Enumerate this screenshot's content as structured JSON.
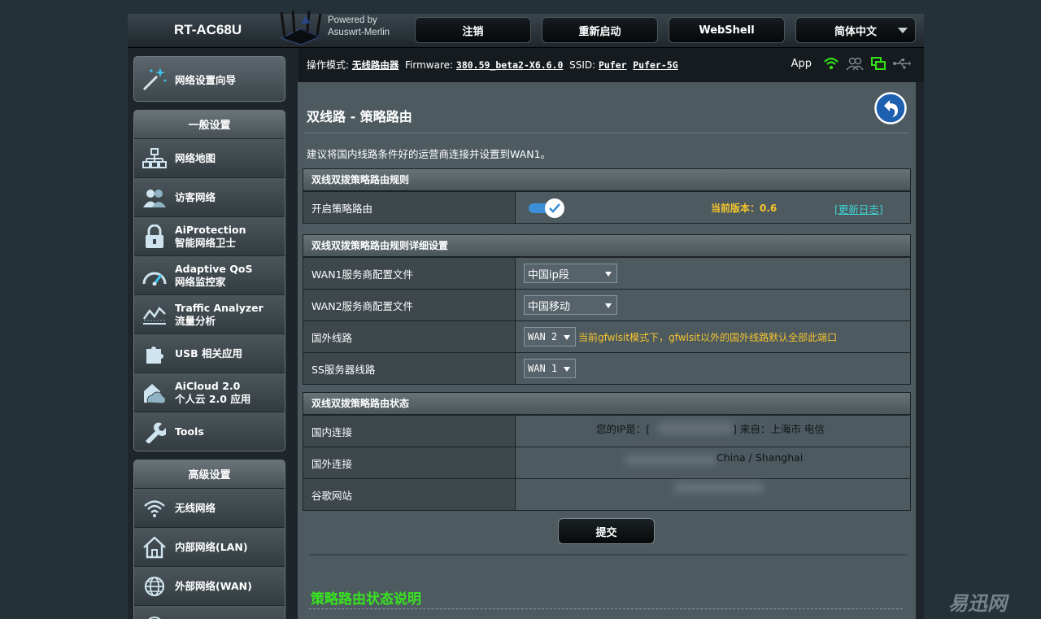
{
  "header": {
    "brand": "RT-AC68U",
    "powered_line1": "Powered by",
    "powered_line2": "Asuswrt-Merlin",
    "buttons": {
      "logout": "注销",
      "reboot": "重新启动",
      "webshell": "WebShell",
      "language": "简体中文"
    }
  },
  "status": {
    "mode_label": "操作模式:",
    "mode_value": "无线路由器",
    "firmware_label": "Firmware:",
    "firmware_value": "380.59_beta2-X6.6.0",
    "ssid_label": "SSID:",
    "ssid1": "Pufer",
    "ssid2": "Pufer-5G",
    "app_label": "App"
  },
  "sidebar": {
    "wizard": "网络设置向导",
    "general_title": "一般设置",
    "general_items": [
      {
        "line1": "网络地图",
        "line2": "",
        "icon": "network-map-icon"
      },
      {
        "line1": "访客网络",
        "line2": "",
        "icon": "guest-network-icon"
      },
      {
        "line1": "AiProtection",
        "line2": "智能网络卫士",
        "icon": "lock-icon"
      },
      {
        "line1": "Adaptive QoS",
        "line2": "网络监控家",
        "icon": "speedometer-icon"
      },
      {
        "line1": "Traffic Analyzer",
        "line2": "流量分析",
        "icon": "chart-icon"
      },
      {
        "line1": "USB 相关应用",
        "line2": "",
        "icon": "puzzle-icon"
      },
      {
        "line1": "AiCloud 2.0",
        "line2": "个人云 2.0 应用",
        "icon": "cloud-icon"
      },
      {
        "line1": "Tools",
        "line2": "",
        "icon": "wrench-icon"
      }
    ],
    "advanced_title": "高级设置",
    "advanced_items": [
      {
        "line1": "无线网络",
        "icon": "wifi-icon"
      },
      {
        "line1": "内部网络(LAN)",
        "icon": "home-icon"
      },
      {
        "line1": "外部网络(WAN)",
        "icon": "globe-icon"
      }
    ]
  },
  "main": {
    "title": "双线路 - 策略路由",
    "description": "建议将国内线路条件好的运营商连接并设置到WAN1。",
    "rules": {
      "header": "双线双拨策略路由规则",
      "enable_label": "开启策略路由",
      "enable_on": true,
      "version_text": "当前版本：0.6",
      "changelog_link": "[更新日志]"
    },
    "details": {
      "header": "双线双拨策略路由规则详细设置",
      "wan1_label": "WAN1服务商配置文件",
      "wan1_value": "中国ip段",
      "wan2_label": "WAN2服务商配置文件",
      "wan2_value": "中国移动",
      "foreign_label": "国外线路",
      "foreign_value": "WAN 2",
      "foreign_note": "当前gfwlsit模式下，gfwlsit以外的国外线路默认全部此端口",
      "ss_label": "SS服务器线路",
      "ss_value": "WAN 1"
    },
    "state": {
      "header": "双线双拨策略路由状态",
      "domestic_label": "国内连接",
      "domestic_prefix": "您的IP是：[",
      "domestic_suffix": "] 来自：上海市 电信",
      "foreign_label": "国外连接",
      "foreign_value": "China / Shanghai",
      "google_label": "谷歌网站"
    },
    "submit": "提交",
    "explain_title": "策略路由状态说明"
  },
  "watermark": "易迅网",
  "colors": {
    "accent_yellow": "#f6c52d",
    "accent_green": "#38e41f",
    "link_cyan": "#3fd5d5",
    "toggle_blue": "#3b8fd6"
  }
}
